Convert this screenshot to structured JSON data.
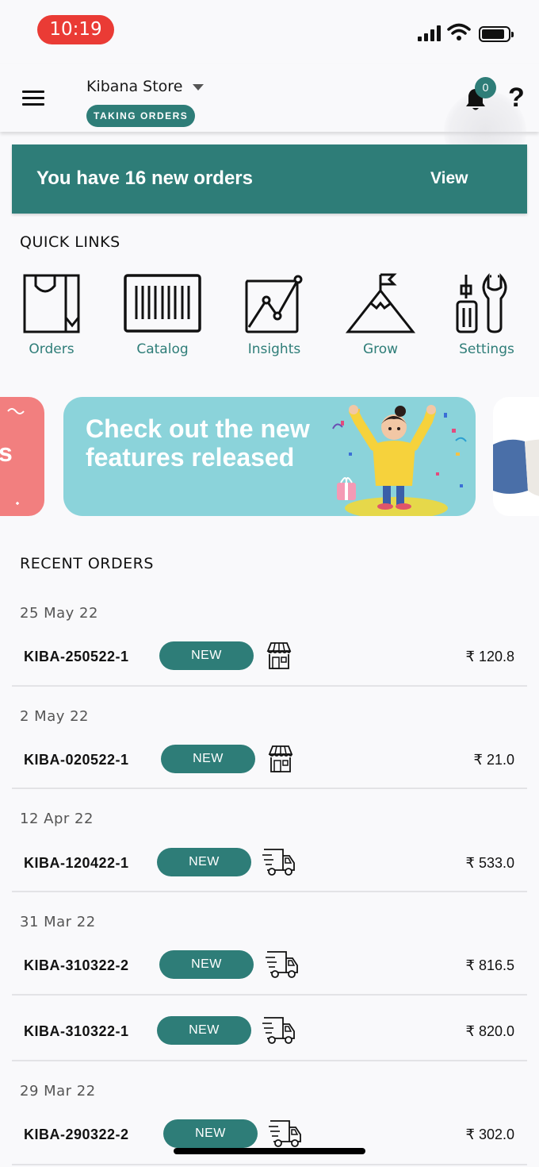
{
  "status_bar": {
    "time": "10:19"
  },
  "header": {
    "store_name": "Kibana Store",
    "store_status": "TAKING ORDERS",
    "notification_count": "0",
    "help_label": "?"
  },
  "new_orders_banner": {
    "message": "You have 16 new orders",
    "action": "View"
  },
  "quick_links": {
    "title": "QUICK LINKS",
    "items": [
      {
        "label": "Orders",
        "icon": "shopping-bag-icon"
      },
      {
        "label": "Catalog",
        "icon": "barcode-icon"
      },
      {
        "label": "Insights",
        "icon": "line-chart-icon"
      },
      {
        "label": "Grow",
        "icon": "mountain-flag-icon"
      },
      {
        "label": "Settings",
        "icon": "tools-icon"
      }
    ]
  },
  "carousel": {
    "left_fragment": "s",
    "main_headline": "Check out the new features released"
  },
  "recent_orders": {
    "title": "RECENT ORDERS",
    "groups": [
      {
        "date": "25 May 22",
        "orders": [
          {
            "id": "KIBA-250522-1",
            "status": "NEW",
            "channel": "store-icon",
            "amount": "₹ 120.8"
          }
        ]
      },
      {
        "date": "2 May 22",
        "orders": [
          {
            "id": "KIBA-020522-1",
            "status": "NEW",
            "channel": "store-icon",
            "amount": "₹ 21.0"
          }
        ]
      },
      {
        "date": "12 Apr 22",
        "orders": [
          {
            "id": "KIBA-120422-1",
            "status": "NEW",
            "channel": "delivery-truck-icon",
            "amount": "₹ 533.0"
          }
        ]
      },
      {
        "date": "31 Mar 22",
        "orders": [
          {
            "id": "KIBA-310322-2",
            "status": "NEW",
            "channel": "delivery-truck-icon",
            "amount": "₹ 816.5"
          },
          {
            "id": "KIBA-310322-1",
            "status": "NEW",
            "channel": "delivery-truck-icon",
            "amount": "₹ 820.0"
          }
        ]
      },
      {
        "date": "29 Mar 22",
        "orders": [
          {
            "id": "KIBA-290322-2",
            "status": "NEW",
            "channel": "delivery-truck-icon",
            "amount": "₹ 302.0"
          }
        ]
      }
    ]
  },
  "colors": {
    "brand": "#2e7d78",
    "promo_coral": "#f27f7f",
    "promo_teal": "#8bd3da",
    "time_pill": "#ea3b35"
  }
}
